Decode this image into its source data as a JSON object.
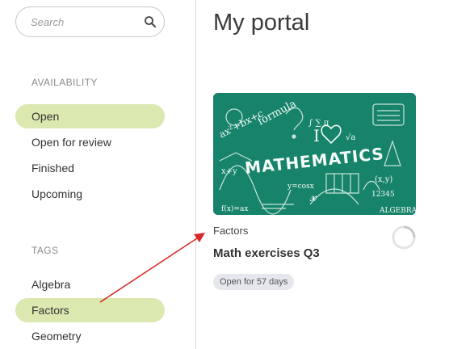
{
  "search": {
    "placeholder": "Search"
  },
  "sidebar": {
    "availability_title": "AVAILABILITY",
    "availability": [
      {
        "label": "Open",
        "active": true
      },
      {
        "label": "Open for review",
        "active": false
      },
      {
        "label": "Finished",
        "active": false
      },
      {
        "label": "Upcoming",
        "active": false
      }
    ],
    "tags_title": "TAGS",
    "tags": [
      {
        "label": "Algebra",
        "active": false
      },
      {
        "label": "Factors",
        "active": true
      },
      {
        "label": "Geometry",
        "active": false
      }
    ]
  },
  "main": {
    "title": "My portal",
    "card": {
      "image_text": "MATHEMATICS",
      "category": "Factors",
      "title": "Math exercises Q3",
      "badge": "Open for 57 days"
    }
  },
  "colors": {
    "accent": "#dbe8b0",
    "card_image": "#16836a",
    "annotation_arrow": "#d42a2a",
    "badge_bg": "#e6e7ec"
  },
  "icons": [
    "search-icon",
    "loading-spinner-icon"
  ]
}
